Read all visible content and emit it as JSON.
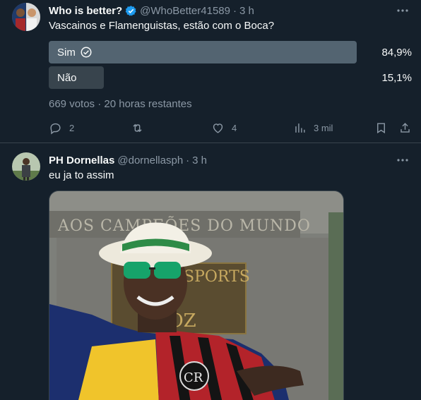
{
  "tweets": [
    {
      "author_name": "Who is better?",
      "handle": "@WhoBetter41589",
      "separator": "·",
      "time": "3 h",
      "text": "Vascainos e Flamenguistas, estão com o Boca?",
      "poll": {
        "options": [
          {
            "label": "Sim",
            "percent": "84,9%",
            "share": 0.849,
            "selected": true
          },
          {
            "label": "Não",
            "percent": "15,1%",
            "share": 0.151,
            "selected": false
          }
        ],
        "votes": "669 votos",
        "meta_separator": "·",
        "remaining": "20 horas restantes"
      },
      "replies": "2",
      "retweets": "",
      "likes": "4",
      "views": "3 mil"
    },
    {
      "author_name": "PH Dornellas",
      "handle": "@dornellasph",
      "separator": "·",
      "time": "3 h",
      "text": "eu ja to assim",
      "media": {
        "plaque_text": "AOS CAMPEÕES DO MUNDO",
        "sign_text": "SPORTS",
        "sign_text_2": "VOZ"
      }
    }
  ],
  "colors": {
    "background": "#15202b",
    "accent": "#1d9bf0",
    "muted": "#8b98a5",
    "border": "#38444d"
  }
}
